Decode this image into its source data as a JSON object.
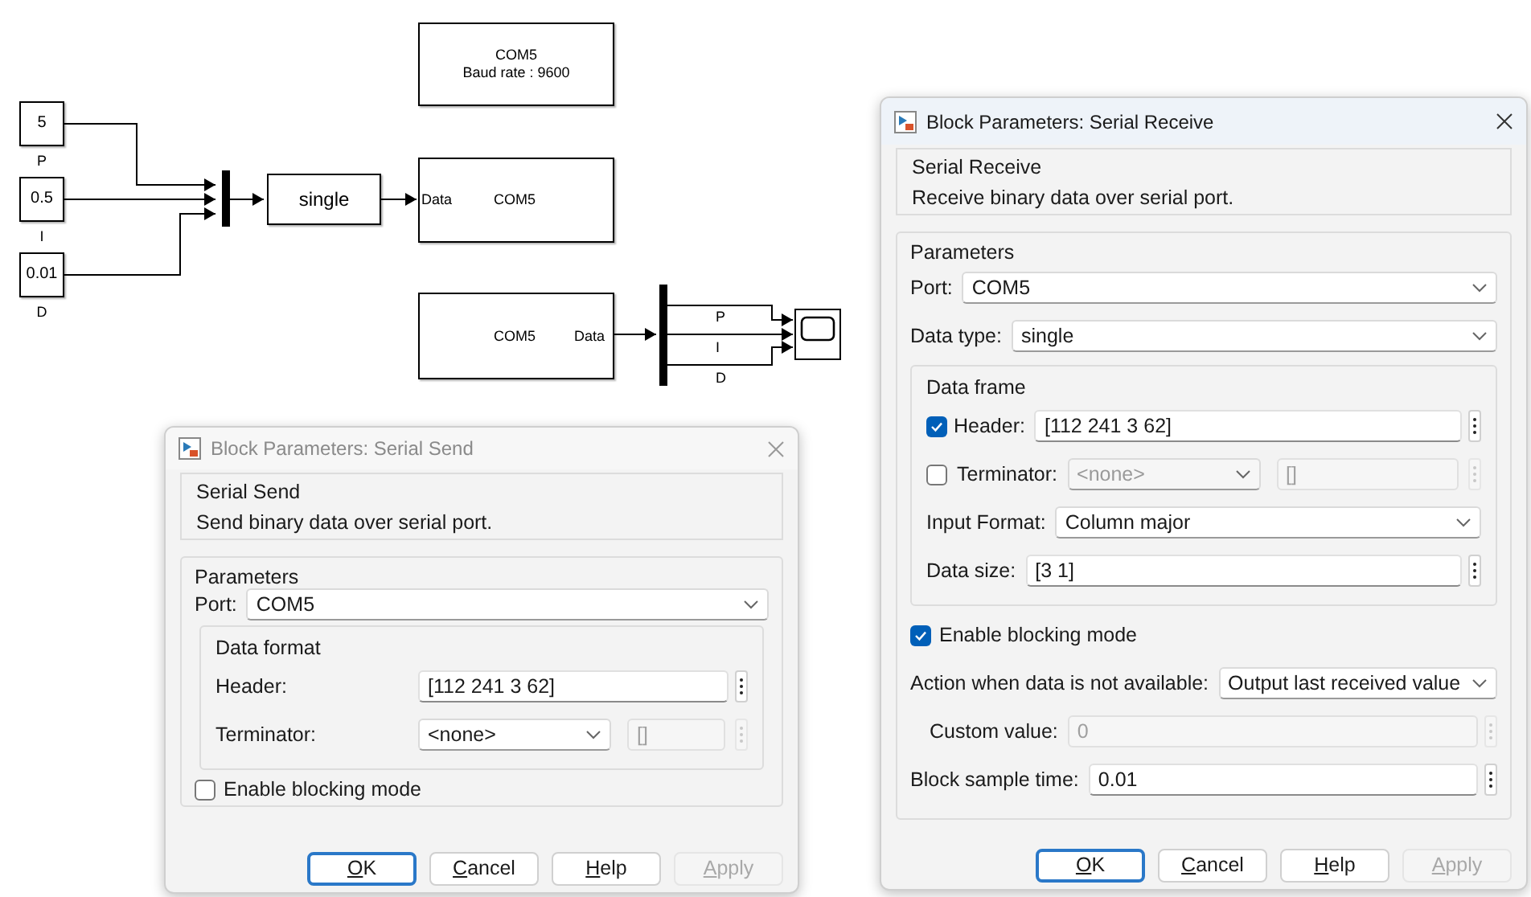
{
  "diagram": {
    "constants": [
      {
        "value": "5",
        "label": "P"
      },
      {
        "value": "0.5",
        "label": "I"
      },
      {
        "value": "0.01",
        "label": "D"
      }
    ],
    "convert_block": {
      "text": "single"
    },
    "config_block": {
      "lines": [
        "COM5",
        "Baud rate : 9600"
      ]
    },
    "send_block": {
      "port": "Data",
      "text": "COM5"
    },
    "receive_block": {
      "text": "COM5",
      "port": "Data"
    },
    "demux_labels": [
      "P",
      "I",
      "D"
    ]
  },
  "dialogs": [
    {
      "title": "Block Parameters: Serial Send",
      "active": false,
      "section_title": "Serial Send",
      "description": "Send binary data over serial port.",
      "parameters_title": "Parameters",
      "rows": [
        {
          "kind": "dropdown",
          "label": "Port:",
          "value": "COM5",
          "disabled": false
        },
        {
          "kind": "group",
          "title": "Data format",
          "rows": [
            {
              "kind": "text",
              "label": "Header:",
              "value": "[112 241 3 62]",
              "disabled": false
            },
            {
              "kind": "dropdown_field",
              "label": "Terminator:",
              "value": "<none>",
              "disabled": false,
              "extra_value": "[]",
              "extra_disabled": true
            }
          ]
        },
        {
          "kind": "checkbox",
          "label": "Enable blocking mode",
          "checked": false
        }
      ],
      "buttons": [
        {
          "label": "OK",
          "default": true,
          "disabled": false
        },
        {
          "label": "Cancel",
          "default": false,
          "disabled": false
        },
        {
          "label": "Help",
          "default": false,
          "disabled": false
        },
        {
          "label": "Apply",
          "default": false,
          "disabled": true
        }
      ]
    },
    {
      "title": "Block Parameters: Serial Receive",
      "active": true,
      "section_title": "Serial Receive",
      "description": "Receive binary data over serial port.",
      "parameters_title": "Parameters",
      "rows": [
        {
          "kind": "dropdown",
          "label": "Port:",
          "value": "COM5",
          "disabled": false
        },
        {
          "kind": "dropdown",
          "label": "Data type:",
          "value": "single",
          "disabled": false
        },
        {
          "kind": "group",
          "title": "Data frame",
          "rows": [
            {
              "kind": "text",
              "label": "Header:",
              "value": "[112 241 3 62]",
              "disabled": false,
              "checked": true
            },
            {
              "kind": "dropdown_field",
              "label": "Terminator:",
              "value": "<none>",
              "disabled": true,
              "extra_value": "[]",
              "extra_disabled": true,
              "checked": false
            },
            {
              "kind": "dropdown",
              "label": "Input Format:",
              "value": "Column major",
              "disabled": false
            },
            {
              "kind": "text",
              "label": "Data size:",
              "value": "[3 1]",
              "disabled": false
            }
          ]
        },
        {
          "kind": "checkbox",
          "label": "Enable blocking mode",
          "checked": true
        },
        {
          "kind": "dropdown",
          "label": "Action when data is not available:",
          "value": "Output last received value",
          "disabled": false
        },
        {
          "kind": "text",
          "label": "Custom value:",
          "value": "0",
          "disabled": true
        },
        {
          "kind": "text",
          "label": "Block sample time:",
          "value": "0.01",
          "disabled": false
        }
      ],
      "buttons": [
        {
          "label": "OK",
          "default": true,
          "disabled": false
        },
        {
          "label": "Cancel",
          "default": false,
          "disabled": false
        },
        {
          "label": "Help",
          "default": false,
          "disabled": false
        },
        {
          "label": "Apply",
          "default": false,
          "disabled": true
        }
      ]
    }
  ]
}
